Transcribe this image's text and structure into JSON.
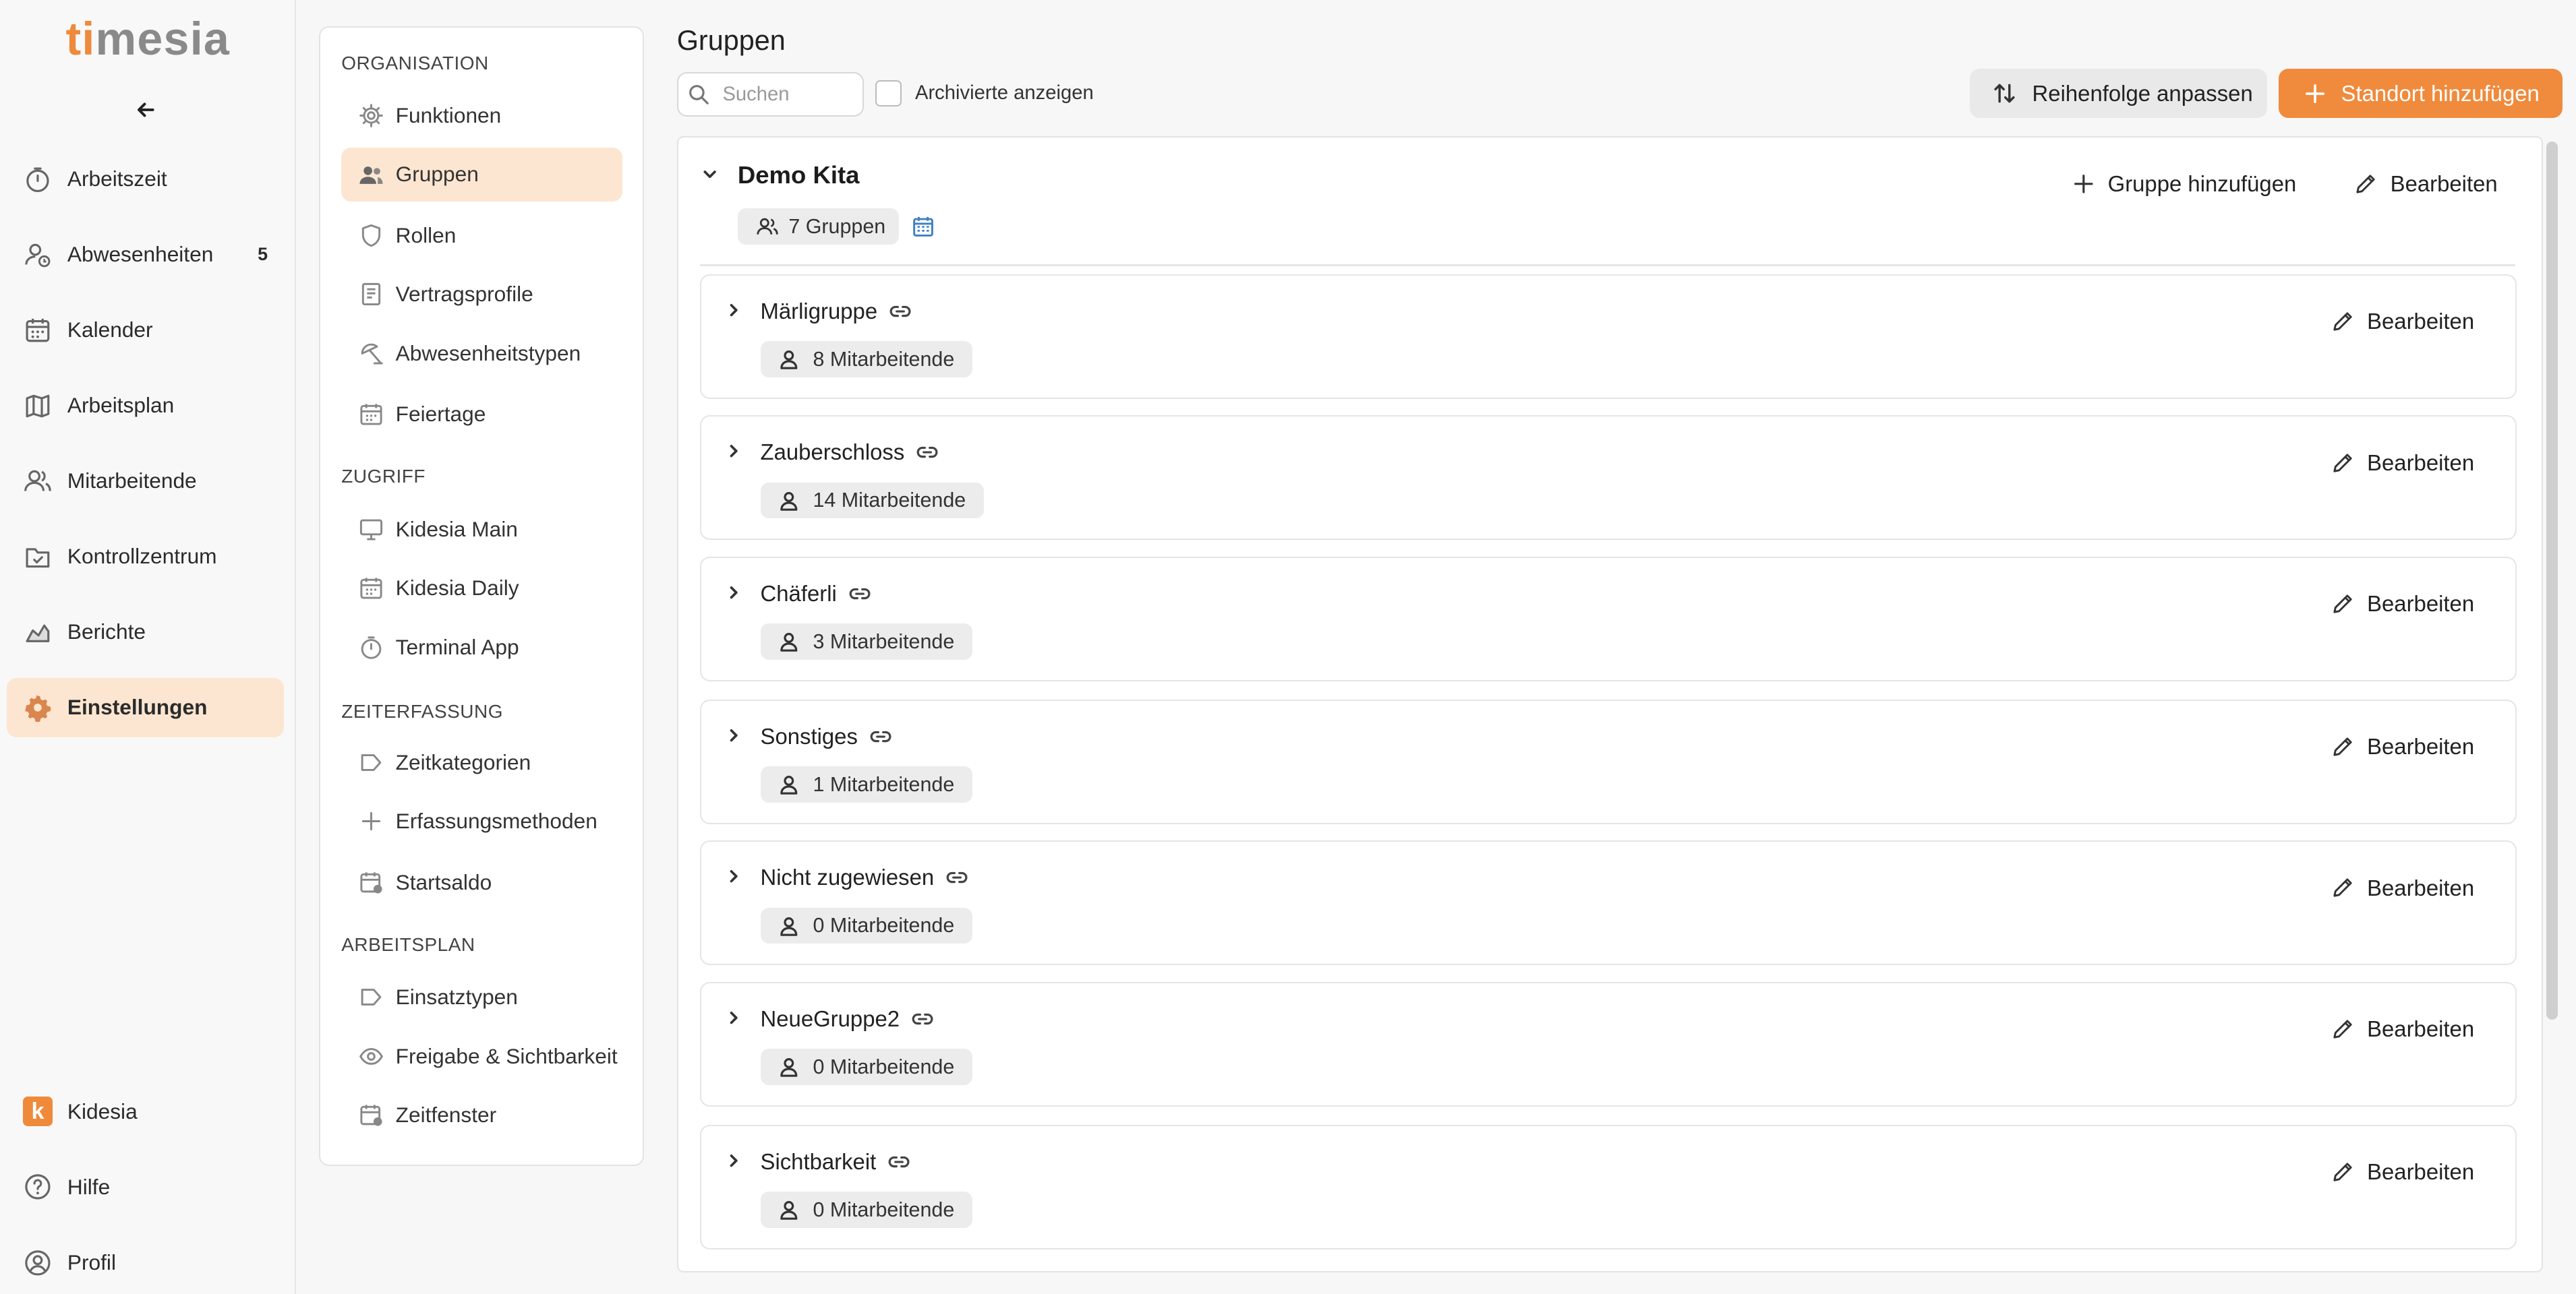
{
  "app": {
    "logo_ti": "ti",
    "logo_rest": "mesia"
  },
  "nav": {
    "items": [
      {
        "label": "Arbeitszeit",
        "icon": "stopwatch-icon"
      },
      {
        "label": "Abwesenheiten",
        "icon": "user-clock-icon",
        "badge": "5"
      },
      {
        "label": "Kalender",
        "icon": "calendar-icon"
      },
      {
        "label": "Arbeitsplan",
        "icon": "map-icon"
      },
      {
        "label": "Mitarbeitende",
        "icon": "users-icon"
      },
      {
        "label": "Kontrollzentrum",
        "icon": "check-folder-icon"
      },
      {
        "label": "Berichte",
        "icon": "chart-area-icon"
      },
      {
        "label": "Einstellungen",
        "icon": "gear-icon",
        "active": true
      }
    ],
    "bottom": [
      {
        "label": "Kidesia",
        "icon": "kidesia-logo"
      },
      {
        "label": "Hilfe",
        "icon": "help-icon"
      },
      {
        "label": "Profil",
        "icon": "profile-icon"
      }
    ]
  },
  "settings": {
    "sections": [
      {
        "title": "ORGANISATION",
        "items": [
          "Funktionen",
          "Gruppen",
          "Rollen",
          "Vertragsprofile",
          "Abwesenheitstypen",
          "Feiertage"
        ]
      },
      {
        "title": "ZUGRIFF",
        "items": [
          "Kidesia Main",
          "Kidesia Daily",
          "Terminal App"
        ]
      },
      {
        "title": "ZEITERFASSUNG",
        "items": [
          "Zeitkategorien",
          "Erfassungsmethoden",
          "Startsaldo"
        ]
      },
      {
        "title": "ARBEITSPLAN",
        "items": [
          "Einsatztypen",
          "Freigabe & Sichtbarkeit",
          "Zeitfenster"
        ]
      }
    ],
    "active": "Gruppen"
  },
  "main": {
    "title": "Gruppen",
    "search_placeholder": "Suchen",
    "archived_label": "Archivierte anzeigen",
    "archived_checked": false,
    "reorder_label": "Reihenfolge anpassen",
    "add_location_label": "Standort hinzufügen",
    "accent_color": "#f08a3c"
  },
  "location": {
    "name": "Demo Kita",
    "groups_count": "7 Gruppen",
    "add_group_label": "Gruppe hinzufügen",
    "edit_label": "Bearbeiten"
  },
  "groups": [
    {
      "name": "Märligruppe",
      "members": "8 Mitarbeitende",
      "edit": "Bearbeiten"
    },
    {
      "name": "Zauberschloss",
      "members": "14 Mitarbeitende",
      "edit": "Bearbeiten"
    },
    {
      "name": "Chäferli",
      "members": "3 Mitarbeitende",
      "edit": "Bearbeiten"
    },
    {
      "name": "Sonstiges",
      "members": "1 Mitarbeitende",
      "edit": "Bearbeiten"
    },
    {
      "name": "Nicht zugewiesen",
      "members": "0 Mitarbeitende",
      "edit": "Bearbeiten"
    },
    {
      "name": "NeueGruppe2",
      "members": "0 Mitarbeitende",
      "edit": "Bearbeiten"
    },
    {
      "name": "Sichtbarkeit",
      "members": "0 Mitarbeitende",
      "edit": "Bearbeiten"
    }
  ]
}
